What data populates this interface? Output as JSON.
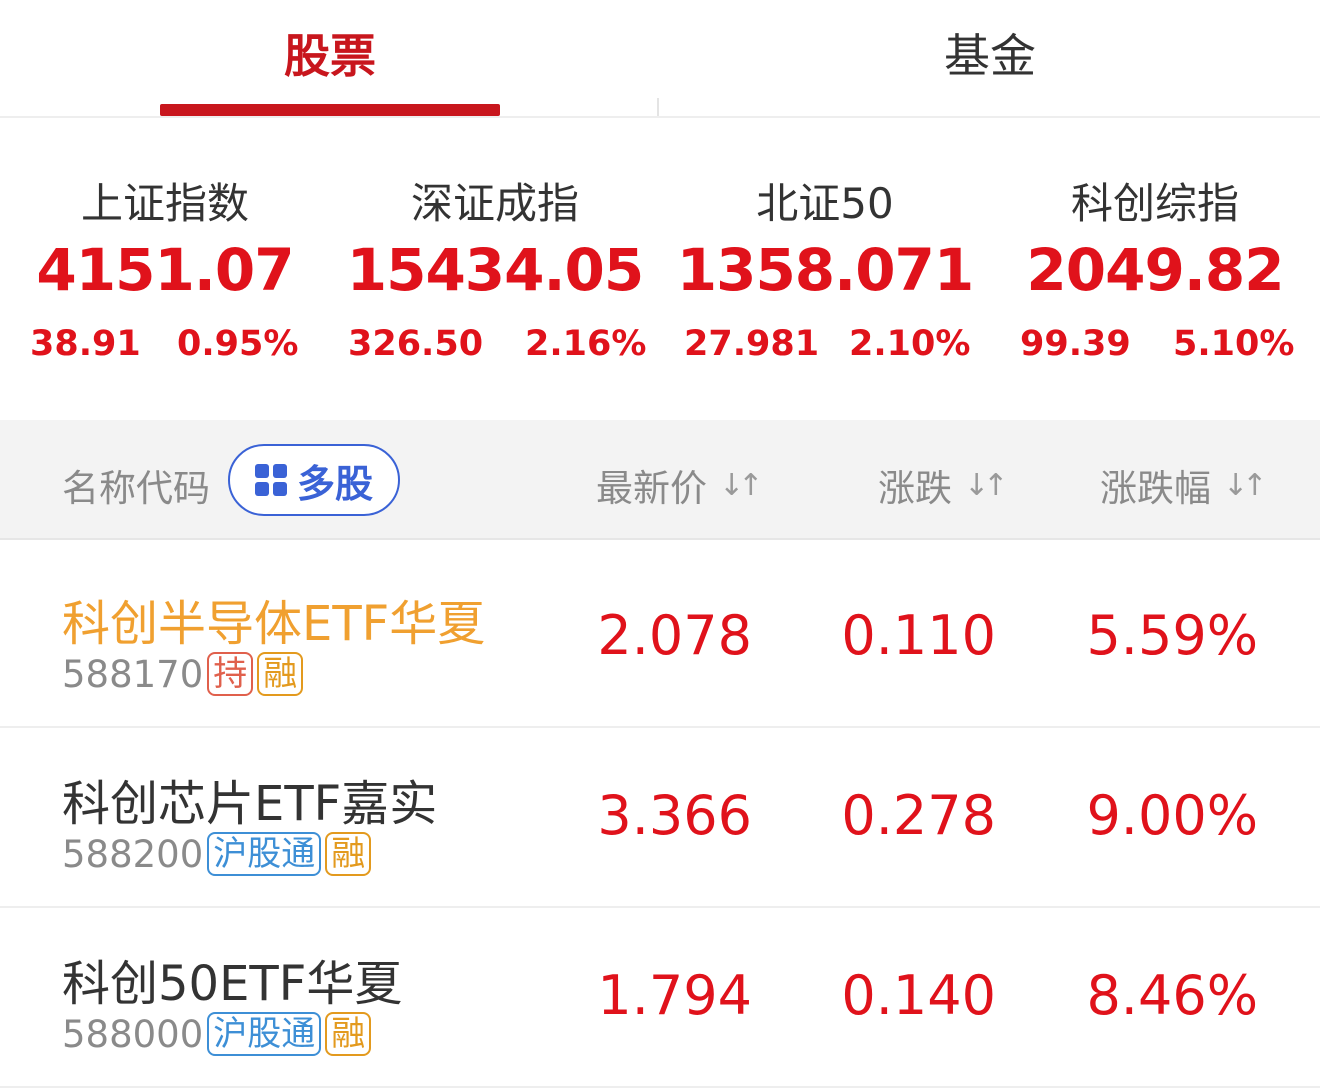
{
  "tabs": [
    {
      "label": "股票",
      "active": true
    },
    {
      "label": "基金",
      "active": false
    }
  ],
  "indexes": [
    {
      "name": "上证指数",
      "value": "4151.07",
      "change": "38.91",
      "pct": "0.95%"
    },
    {
      "name": "深证成指",
      "value": "15434.05",
      "change": "326.50",
      "pct": "2.16%"
    },
    {
      "name": "北证50",
      "value": "1358.071",
      "change": "27.981",
      "pct": "2.10%"
    },
    {
      "name": "科创综指",
      "value": "2049.82",
      "change": "99.39",
      "pct": "5.10%"
    }
  ],
  "header": {
    "name_code": "名称代码",
    "multi_stock": "多股",
    "price": "最新价",
    "change": "涨跌",
    "change_pct": "涨跌幅"
  },
  "rows": [
    {
      "name": "科创半导体ETF华夏",
      "code": "588170",
      "tags": [
        "持",
        "融"
      ],
      "price": "2.078",
      "change": "0.110",
      "pct": "5.59%",
      "highlight": true
    },
    {
      "name": "科创芯片ETF嘉实",
      "code": "588200",
      "tags": [
        "沪股通",
        "融"
      ],
      "price": "3.366",
      "change": "0.278",
      "pct": "9.00%",
      "highlight": false
    },
    {
      "name": "科创50ETF华夏",
      "code": "588000",
      "tags": [
        "沪股通",
        "融"
      ],
      "price": "1.794",
      "change": "0.140",
      "pct": "8.46%",
      "highlight": false
    }
  ],
  "colors": {
    "accent": "#c8161d",
    "up": "#e0121b",
    "highlight_name": "#f0a030",
    "multi_button": "#3a62d6"
  },
  "icons": {
    "multi_stock": "grid-icon",
    "sort": "sort-icon"
  }
}
